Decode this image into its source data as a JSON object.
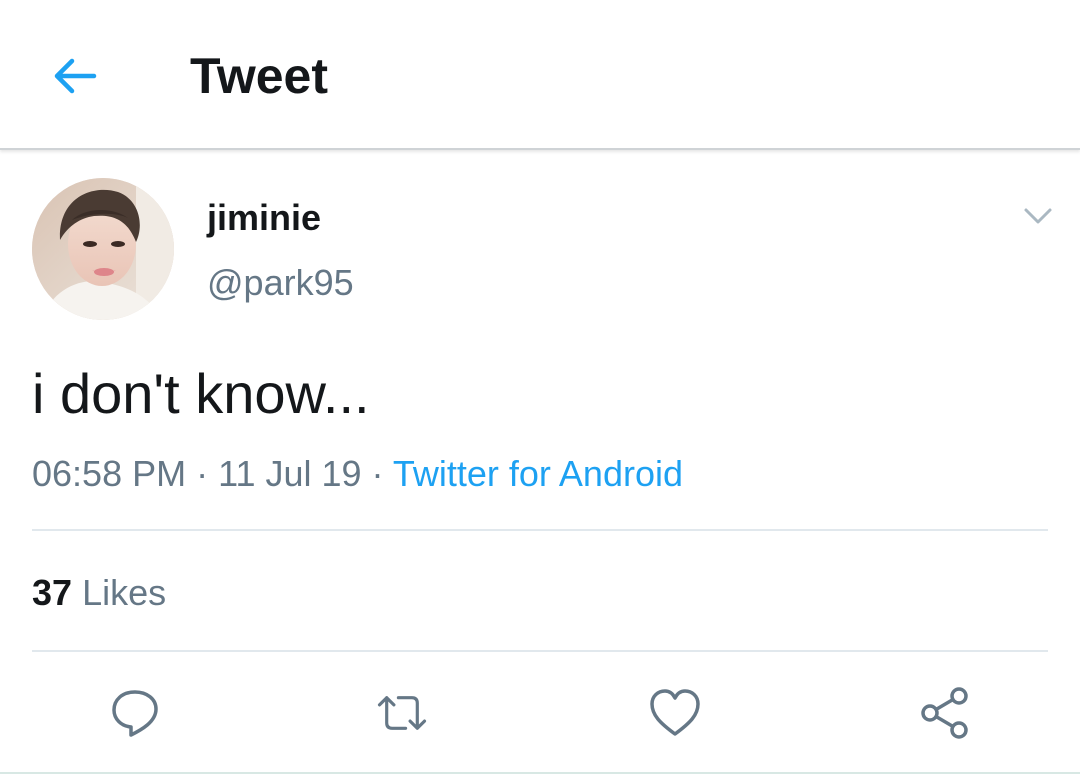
{
  "header": {
    "title": "Tweet",
    "back_icon": "arrow-left-icon"
  },
  "tweet": {
    "display_name": "jiminie",
    "handle": "@park95",
    "text": "i don't know...",
    "time": "06:58 PM",
    "separator": " · ",
    "date": "11 Jul 19",
    "source": "Twitter for Android",
    "likes_count": "37",
    "likes_label": "Likes"
  },
  "actions": [
    {
      "icon": "reply-icon"
    },
    {
      "icon": "retweet-icon"
    },
    {
      "icon": "heart-icon"
    },
    {
      "icon": "share-icon"
    }
  ],
  "colors": {
    "accent": "#1da1f2",
    "text": "#14171a",
    "muted": "#657786",
    "icon": "#657786",
    "divider": "#e1e8ed"
  }
}
